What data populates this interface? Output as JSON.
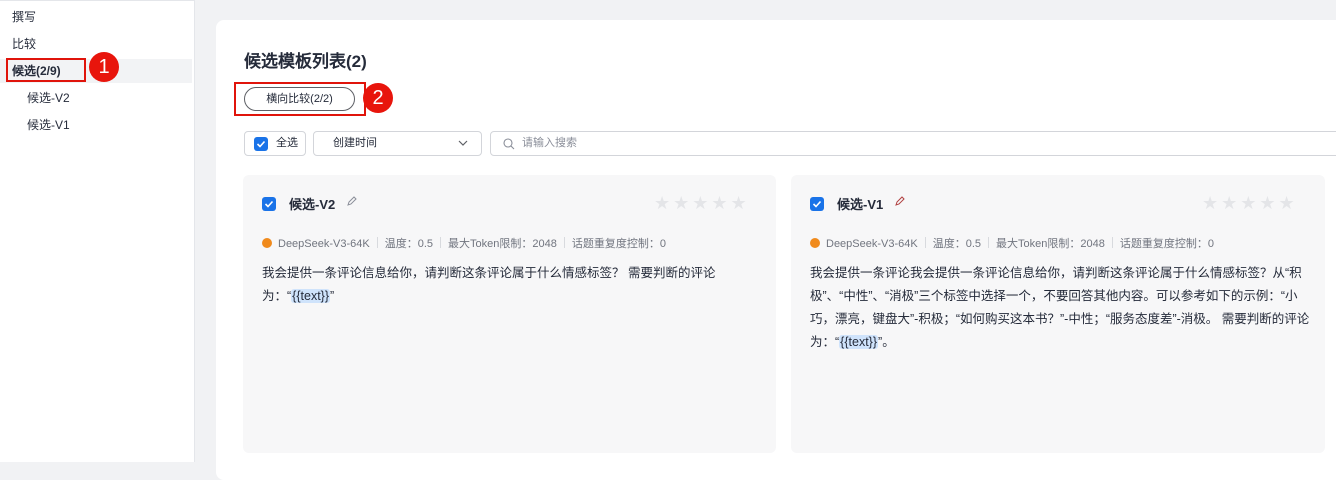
{
  "sidebar": {
    "items": [
      {
        "label": "撰写"
      },
      {
        "label": "比较"
      },
      {
        "label": "候选(2/9)"
      },
      {
        "label": "候选-V2"
      },
      {
        "label": "候选-V1"
      }
    ]
  },
  "annotations": [
    "1",
    "2"
  ],
  "main": {
    "title": "候选模板列表(2)",
    "compare_button": "横向比较(2/2)",
    "select_all": "全选",
    "sort_value": "创建时间",
    "search_placeholder": "请输入搜索"
  },
  "cards": [
    {
      "name": "候选-V2",
      "checked": true,
      "model": "DeepSeek-V3-64K",
      "temperature": "温度：0.5",
      "max_tokens": "最大Token限制：2048",
      "repeat": "话题重复度控制：0",
      "rating": 0,
      "text_before": "我会提供一条评论信息给你，请判断这条评论属于什么情感标签？ 需要判断的评论为：“",
      "var": "{{text}}",
      "text_after": "”"
    },
    {
      "name": "候选-V1",
      "checked": true,
      "model": "DeepSeek-V3-64K",
      "temperature": "温度：0.5",
      "max_tokens": "最大Token限制：2048",
      "repeat": "话题重复度控制：0",
      "rating": 0,
      "text_before": "我会提供一条评论我会提供一条评论信息给你，请判断这条评论属于什么情感标签？从“积极”、“中性”、“消极”三个标签中选择一个，不要回答其他内容。可以参考如下的示例：“小巧，漂亮，键盘大”-积极；“如何购买这本书？”-中性；“服务态度差”-消极。 需要判断的评论为：“",
      "var": "{{text}}",
      "text_after": "”。"
    }
  ],
  "colors": {
    "accent": "#1a73e8",
    "annotation": "#e8150c",
    "model_icon": "#f08a1c"
  }
}
